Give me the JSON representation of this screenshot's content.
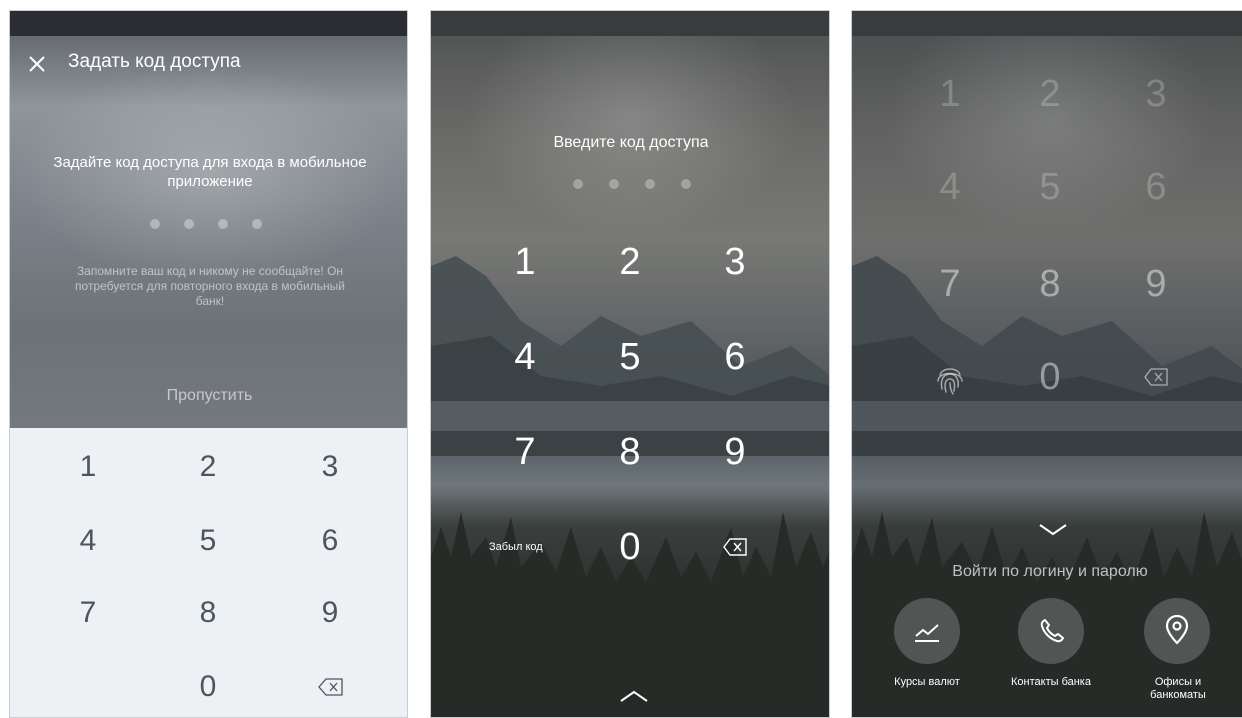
{
  "screen1": {
    "title": "Задать код доступа",
    "prompt": "Задайте код доступа для входа в мобильное приложение",
    "hint": "Запомните ваш код и никому не сообщайте! Он потребуется для повторного входа в мобильный банк!",
    "skip_label": "Пропустить",
    "keys": [
      "1",
      "2",
      "3",
      "4",
      "5",
      "6",
      "7",
      "8",
      "9",
      "0"
    ]
  },
  "screen2": {
    "prompt": "Введите код доступа",
    "keys": [
      "1",
      "2",
      "3",
      "4",
      "5",
      "6",
      "7",
      "8",
      "9",
      "0"
    ],
    "forgot_label": "Забыл код"
  },
  "screen3": {
    "keys": [
      "1",
      "2",
      "3",
      "4",
      "5",
      "6",
      "7",
      "8",
      "9",
      "0"
    ],
    "login_label": "Войти по логину и паролю",
    "actions": [
      {
        "label": "Курсы валют",
        "icon": "chart-line-icon"
      },
      {
        "label": "Контакты банка",
        "icon": "phone-icon"
      },
      {
        "label": "Офисы и банкоматы",
        "icon": "location-pin-icon"
      }
    ]
  },
  "colors": {
    "keypad_light_bg": "#eef1f4",
    "keypad_light_digit": "#4b5560",
    "statusbar": "#2b2d33"
  }
}
